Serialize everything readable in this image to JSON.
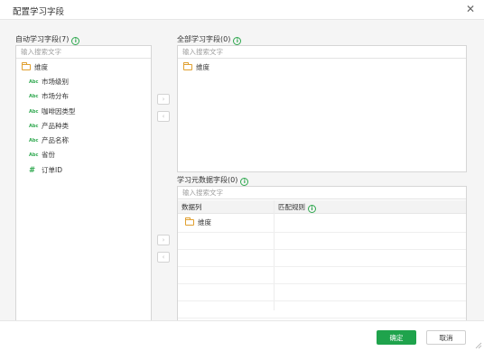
{
  "dialog": {
    "title": "配置学习字段",
    "close_icon": "close-icon"
  },
  "auto_fields": {
    "label": "自动学习字段(7)",
    "search_placeholder": "输入搜索文字",
    "folder": "维度",
    "items": [
      {
        "type": "Abc",
        "label": "市场级别"
      },
      {
        "type": "Abc",
        "label": "市场分布"
      },
      {
        "type": "Abc",
        "label": "咖啡因类型"
      },
      {
        "type": "Abc",
        "label": "产品种类"
      },
      {
        "type": "Abc",
        "label": "产品名称"
      },
      {
        "type": "Abc",
        "label": "省份"
      },
      {
        "type": "#",
        "label": "订单ID"
      }
    ]
  },
  "all_fields": {
    "label": "全部学习字段(0)",
    "search_placeholder": "输入搜索文字",
    "folder": "维度"
  },
  "meta_fields": {
    "label": "学习元数据字段(0)",
    "search_placeholder": "输入搜索文字",
    "col_data": "数据列",
    "col_rule": "匹配规则",
    "folder": "维度"
  },
  "arrows": {
    "right": "›",
    "left": "‹"
  },
  "footer": {
    "ok": "确定",
    "cancel": "取消"
  },
  "colors": {
    "accent": "#1fa34c",
    "folder": "#e0a030"
  }
}
